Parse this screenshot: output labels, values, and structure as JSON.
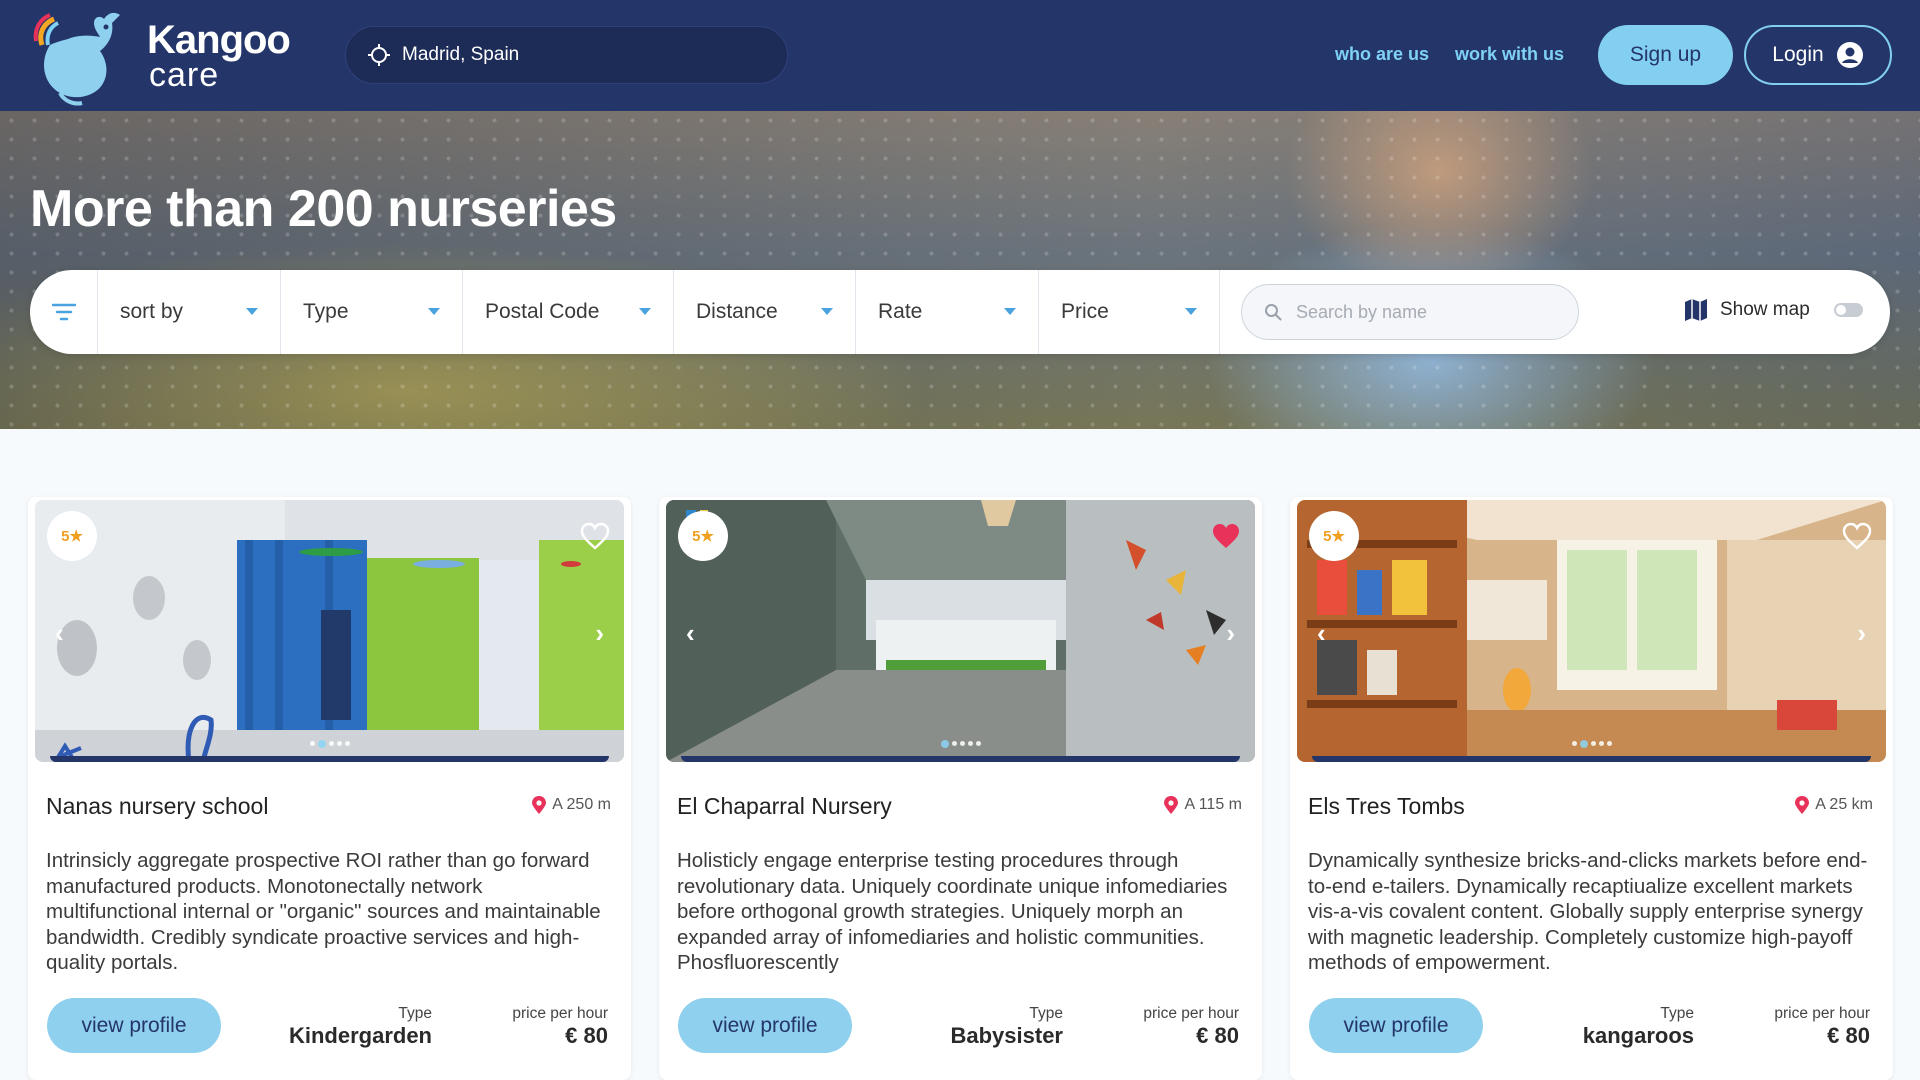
{
  "header": {
    "brand_top": "Kangoo",
    "brand_bottom": "care",
    "location": "Madrid, Spain",
    "nav": [
      "who are us",
      "work with us"
    ],
    "signup_label": "Sign up",
    "login_label": "Login"
  },
  "hero": {
    "title": "More than 200 nurseries",
    "filters": [
      "sort by",
      "Type",
      "Postal Code",
      "Distance",
      "Rate",
      "Price"
    ],
    "search_placeholder": "Search by name",
    "show_map_label": "Show map",
    "show_map_enabled": false
  },
  "cards": [
    {
      "rating": "5",
      "favorite": false,
      "name": "Nanas nursery school",
      "distance": "A 250 m",
      "description": "Intrinsicly aggregate prospective ROI rather than go forward manufactured products. Monotonectally network multifunctional internal or \"organic\" sources and maintainable bandwidth. Credibly syndicate proactive services and high-quality portals.",
      "button": "view profile",
      "type_label": "Type",
      "type": "Kindergarden",
      "price_label": "price per hour",
      "price": "€ 80",
      "slides": 5,
      "active_slide": 1
    },
    {
      "rating": "5",
      "favorite": true,
      "name": "El Chaparral Nursery",
      "distance": "A 115 m",
      "description": "Holisticly engage enterprise testing procedures through revolutionary data. Uniquely coordinate unique infomediaries before orthogonal growth strategies. Uniquely morph an expanded array of infomediaries and holistic communities. Phosfluorescently",
      "button": "view profile",
      "type_label": "Type",
      "type": "Babysister",
      "price_label": "price per hour",
      "price": "€ 80",
      "slides": 5,
      "active_slide": 0
    },
    {
      "rating": "5",
      "favorite": false,
      "name": "Els Tres Tombs",
      "distance": "A 25 km",
      "description": "Dynamically synthesize bricks-and-clicks markets before end-to-end e-tailers. Dynamically recaptiualize excellent markets vis-a-vis covalent content. Globally supply enterprise synergy with magnetic leadership. Completely customize high-payoff methods of empowerment.",
      "button": "view profile",
      "type_label": "Type",
      "type": "kangaroos",
      "price_label": "price per hour",
      "price": "€ 80",
      "slides": 5,
      "active_slide": 1
    }
  ],
  "colors": {
    "header_bg": "#24356a",
    "accent": "#82cff2",
    "heart_active": "#e8325a",
    "pin": "#e8325a",
    "star": "#f0a020"
  }
}
